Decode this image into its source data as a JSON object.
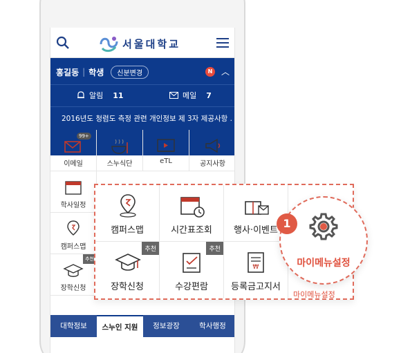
{
  "header": {
    "logo_text": "서울대학교",
    "search_icon": "search-icon",
    "menu_icon": "hamburger-icon",
    "brand_color": "#1d3f87"
  },
  "user": {
    "name": "홍길동",
    "role": "학생",
    "role_button": "신분변경",
    "new_badge": "N",
    "alarm_label": "알림",
    "alarm_count": "11",
    "mail_label": "메일",
    "mail_count": "7",
    "notice": "2016년도 청렴도 측정 관련 개인정보 제 3자 제공사항 ..",
    "bar_color": "#0d3a8c"
  },
  "grid": {
    "items": [
      {
        "label": "이메일",
        "badge": "99+"
      },
      {
        "label": "스누식단"
      },
      {
        "label": "eTL"
      },
      {
        "label": "공지사항"
      },
      {
        "label": "학사일정"
      },
      {
        "label": "캠퍼스맵"
      },
      {
        "label": "장학신청",
        "badge": "추천"
      }
    ]
  },
  "tabs": [
    "대학정보",
    "스누인 지원",
    "정보광장",
    "학사행정"
  ],
  "zoom": {
    "items": [
      {
        "label": "캠퍼스맵"
      },
      {
        "label": "시간표조회"
      },
      {
        "label": "행사·이벤트"
      },
      {
        "label": "장학신청",
        "badge": "추천"
      },
      {
        "label": "수강편람",
        "badge": "추천"
      },
      {
        "label": "등록금고지서"
      }
    ],
    "peek_label": "마이메뉴설정",
    "highlight_color": "#e05a45"
  },
  "callout": {
    "step_number": "1",
    "label": "마이메뉴설정"
  }
}
